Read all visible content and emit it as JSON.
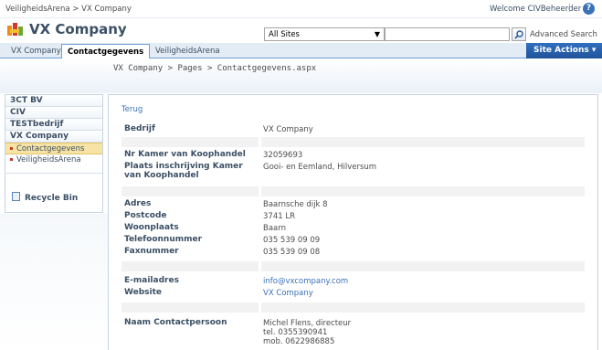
{
  "topbar": {
    "breadcrumb": "VeiligheidsArena > VX Company",
    "welcome": "Welcome CIVBeheerder",
    "separator": "|",
    "help": "?"
  },
  "header": {
    "site_title": "VX Company",
    "scope_value": "All Sites",
    "search_value": "",
    "advanced_search": "Advanced Search"
  },
  "tabs": [
    {
      "label": "VX Company"
    },
    {
      "label": "Contactgegevens"
    },
    {
      "label": "VeiligheidsArena"
    }
  ],
  "site_actions": "Site Actions",
  "page_breadcrumb": "VX Company > Pages > Contactgegevens.aspx",
  "leftnav": {
    "items": [
      {
        "label": "3CT BV"
      },
      {
        "label": "CIV"
      },
      {
        "label": "TESTbedrijf"
      },
      {
        "label": "VX Company"
      }
    ],
    "sub": [
      {
        "label": "Contactgegevens"
      },
      {
        "label": "VeiligheidsArena"
      }
    ],
    "recycle": "Recycle Bin"
  },
  "main": {
    "back": "Terug",
    "fields": {
      "bedrijf": {
        "label": "Bedrijf",
        "value": "VX Company"
      },
      "kvk": {
        "label": "Nr Kamer van Koophandel",
        "value": "32059693"
      },
      "plaats": {
        "label": "Plaats inschrijving Kamer van Koophandel",
        "value": "Gooi- en Eemland, Hilversum"
      },
      "adres": {
        "label": "Adres",
        "value": "Baarnsche dijk 8"
      },
      "postcode": {
        "label": "Postcode",
        "value": "3741 LR"
      },
      "woonplaats": {
        "label": "Woonplaats",
        "value": "Baarn"
      },
      "telefoon": {
        "label": "Telefoonnummer",
        "value": "035 539 09 09"
      },
      "fax": {
        "label": "Faxnummer",
        "value": "035 539 09 08"
      },
      "email": {
        "label": "E-mailadres",
        "value": "info@vxcompany.com"
      },
      "website": {
        "label": "Website",
        "value": "VX Company"
      },
      "contact": {
        "label": "Naam Contactpersoon",
        "line1": "Michel Flens, directeur",
        "line2": "tel. 0355390941",
        "line3": "mob. 0622986885"
      }
    }
  }
}
